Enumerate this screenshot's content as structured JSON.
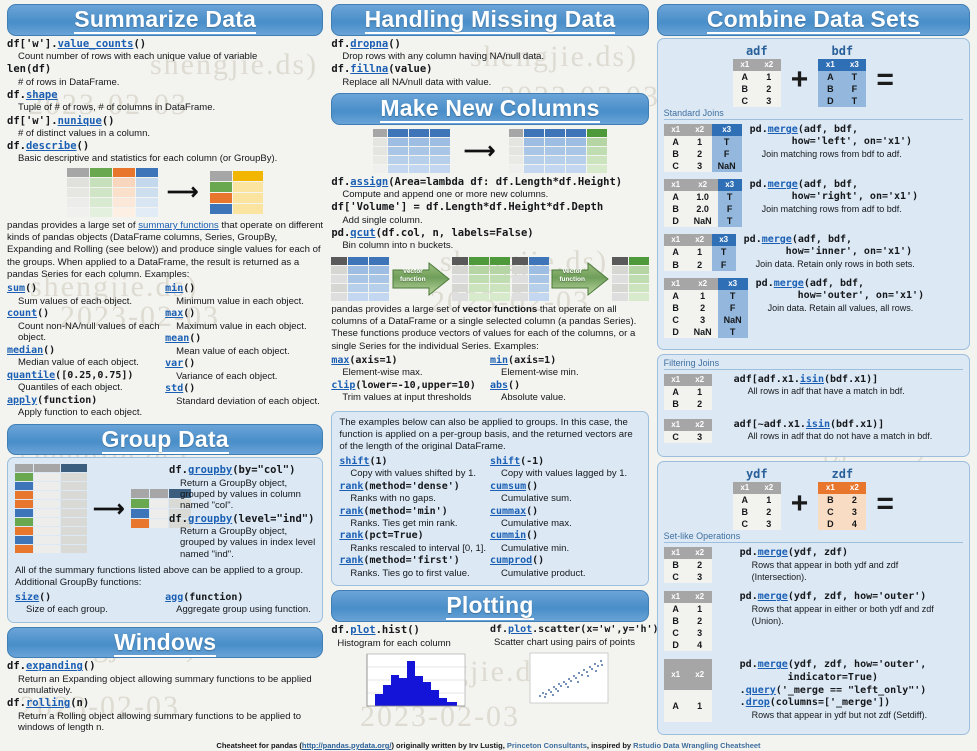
{
  "sections": {
    "summarize": {
      "title": "Summarize Data",
      "entries": [
        {
          "code_pre": "df['w'].",
          "code_link": "value_counts",
          "code_post": "()",
          "desc": "Count number of rows with each unique value of variable"
        },
        {
          "code_pre": "len(df)",
          "code_link": "",
          "code_post": "",
          "desc": "# of rows in DataFrame."
        },
        {
          "code_pre": "df.",
          "code_link": "shape",
          "code_post": "",
          "desc": "Tuple of # of rows, # of columns in DataFrame."
        },
        {
          "code_pre": "df['w'].",
          "code_link": "nunique",
          "code_post": "()",
          "desc": "# of distinct values in a column."
        },
        {
          "code_pre": "df.",
          "code_link": "describe",
          "code_post": "()",
          "desc": "Basic descriptive and statistics for each column (or GroupBy)."
        }
      ],
      "prose_1": "pandas provides a large set of ",
      "prose_link": "summary functions",
      "prose_2": " that operate on different kinds of pandas objects (DataFrame columns, Series, GroupBy, Expanding and Rolling (see below)) and produce single values for each of the groups. When applied to a DataFrame, the result is returned as a pandas Series for each column. Examples:",
      "funcs_left": [
        {
          "name": "sum",
          "args": "()",
          "desc": "Sum values of each object."
        },
        {
          "name": "count",
          "args": "()",
          "desc": "Count non-NA/null values of each object."
        },
        {
          "name": "median",
          "args": "()",
          "desc": "Median value of each object."
        },
        {
          "name": "quantile",
          "args": "([0.25,0.75])",
          "desc": "Quantiles of each object."
        },
        {
          "name": "apply",
          "args": "(function)",
          "desc": "Apply function to each object."
        }
      ],
      "funcs_right": [
        {
          "name": "min",
          "args": "()",
          "desc": "Minimum value in each object."
        },
        {
          "name": "max",
          "args": "()",
          "desc": "Maximum value in each object."
        },
        {
          "name": "mean",
          "args": "()",
          "desc": "Mean value of each object."
        },
        {
          "name": "var",
          "args": "()",
          "desc": "Variance of each object."
        },
        {
          "name": "std",
          "args": "()",
          "desc": "Standard deviation of each object."
        }
      ]
    },
    "group": {
      "title": "Group Data",
      "entries": [
        {
          "code_pre": "df.",
          "code_link": "groupby",
          "code_post": "(by=\"col\")",
          "desc": "Return a GroupBy object, grouped by values in column named \"col\"."
        },
        {
          "code_pre": "df.",
          "code_link": "groupby",
          "code_post": "(level=\"ind\")",
          "desc": "Return a GroupBy object, grouped by values in index level named \"ind\"."
        }
      ],
      "note": "All of the summary functions listed above can be applied to a group. Additional GroupBy functions:",
      "funcs_left": [
        {
          "name": "size",
          "args": "()",
          "desc": "Size of each group."
        }
      ],
      "funcs_right": [
        {
          "name": "agg",
          "args": "(function)",
          "desc": "Aggregate group using function."
        }
      ]
    },
    "windows": {
      "title": "Windows",
      "entries": [
        {
          "code_pre": "df.",
          "code_link": "expanding",
          "code_post": "()",
          "desc": "Return an Expanding object allowing summary functions to be applied cumulatively."
        },
        {
          "code_pre": "df.",
          "code_link": "rolling",
          "code_post": "(n)",
          "desc": "Return a Rolling object allowing summary functions to be applied to windows of length n."
        }
      ]
    },
    "missing": {
      "title": "Handling Missing Data",
      "entries": [
        {
          "code_pre": "df.",
          "code_link": "dropna",
          "code_post": "()",
          "desc": "Drop rows with any column having NA/null data."
        },
        {
          "code_pre": "df.",
          "code_link": "fillna",
          "code_post": "(value)",
          "desc": "Replace all NA/null data with value."
        }
      ]
    },
    "newcols": {
      "title": "Make New Columns",
      "entries": [
        {
          "code_pre": "df.",
          "code_link": "assign",
          "code_post": "(Area=lambda df: df.Length*df.Height)",
          "desc": "Compute and append one or more new columns."
        },
        {
          "code_pre": "df['Volume'] = df.Length*df.Height*df.Depth",
          "code_link": "",
          "code_post": "",
          "desc": "Add single column."
        },
        {
          "code_pre": "pd.",
          "code_link": "qcut",
          "code_post": "(df.col, n, labels=False)",
          "desc": "Bin column into n buckets."
        }
      ],
      "vector_label_1": "Vector",
      "vector_label_2": "function",
      "prose_1": "pandas provides a large set of ",
      "prose_bold": "vector functions",
      "prose_2": " that operate on all columns of a DataFrame or a single selected column (a pandas Series). These functions produce vectors of values for each of the columns, or a single Series for the individual Series. Examples:",
      "funcs_left": [
        {
          "name": "max",
          "args": "(axis=1)",
          "desc": "Element-wise max."
        },
        {
          "name": "clip",
          "args": "(lower=-10,upper=10)",
          "desc": "Trim values at input thresholds"
        }
      ],
      "funcs_right": [
        {
          "name": "min",
          "args": "(axis=1)",
          "desc": "Element-wise min."
        },
        {
          "name": "abs",
          "args": "()",
          "desc": "Absolute value."
        }
      ]
    },
    "groupvectors": {
      "note": "The examples below can also be applied to groups. In this case, the function is applied on a per-group basis, and the returned vectors are of the length of the original DataFrame.",
      "funcs_left": [
        {
          "name": "shift",
          "args": "(1)",
          "desc": "Copy with values shifted by 1."
        },
        {
          "name": "rank",
          "args": "(method='dense')",
          "desc": "Ranks with no gaps."
        },
        {
          "name": "rank",
          "args": "(method='min')",
          "desc": "Ranks. Ties get min rank."
        },
        {
          "name": "rank",
          "args": "(pct=True)",
          "desc": "Ranks rescaled to interval [0, 1]."
        },
        {
          "name": "rank",
          "args": "(method='first')",
          "desc": "Ranks. Ties go to first value."
        }
      ],
      "funcs_right": [
        {
          "name": "shift",
          "args": "(-1)",
          "desc": "Copy with values lagged by 1."
        },
        {
          "name": "cumsum",
          "args": "()",
          "desc": "Cumulative sum."
        },
        {
          "name": "cummax",
          "args": "()",
          "desc": "Cumulative max."
        },
        {
          "name": "cummin",
          "args": "()",
          "desc": "Cumulative min."
        },
        {
          "name": "cumprod",
          "args": "()",
          "desc": "Cumulative product."
        }
      ]
    },
    "plotting": {
      "title": "Plotting",
      "left": {
        "code_pre": "df.",
        "code_link": "plot",
        "code_post": ".hist()",
        "desc": "Histogram for each column"
      },
      "right": {
        "code_pre": "df.",
        "code_link": "plot",
        "code_post": ".scatter(x='w',y='h')",
        "desc": "Scatter chart using pairs of points"
      }
    },
    "combine": {
      "title": "Combine Data Sets",
      "adf_name": "adf",
      "bdf_name": "bdf",
      "ydf_name": "ydf",
      "zdf_name": "zdf",
      "plus": "+",
      "equals": "=",
      "standard_joins_label": "Standard Joins",
      "filtering_joins_label": "Filtering Joins",
      "setlike_label": "Set-like Operations",
      "adf": {
        "headers": [
          "x1",
          "x2"
        ],
        "rows": [
          [
            "A",
            "1"
          ],
          [
            "B",
            "2"
          ],
          [
            "C",
            "3"
          ]
        ]
      },
      "bdf": {
        "headers": [
          "x1",
          "x3"
        ],
        "rows": [
          [
            "A",
            "T"
          ],
          [
            "B",
            "F"
          ],
          [
            "D",
            "T"
          ]
        ]
      },
      "ydf": {
        "headers": [
          "x1",
          "x2"
        ],
        "rows": [
          [
            "A",
            "1"
          ],
          [
            "B",
            "2"
          ],
          [
            "C",
            "3"
          ]
        ]
      },
      "zdf": {
        "headers": [
          "x1",
          "x2"
        ],
        "rows": [
          [
            "B",
            "2"
          ],
          [
            "C",
            "3"
          ],
          [
            "D",
            "4"
          ]
        ]
      },
      "joins": [
        {
          "headers": [
            "x1",
            "x2",
            "x3"
          ],
          "rows": [
            [
              "A",
              "1",
              "T"
            ],
            [
              "B",
              "2",
              "F"
            ],
            [
              "C",
              "3",
              "NaN"
            ]
          ],
          "code_pre": "pd.",
          "code_link": "merge",
          "code_post": "(adf, bdf,",
          "code_line2": "how='left', on='x1')",
          "desc": "Join matching rows from bdf to adf."
        },
        {
          "headers": [
            "x1",
            "x2",
            "x3"
          ],
          "rows": [
            [
              "A",
              "1.0",
              "T"
            ],
            [
              "B",
              "2.0",
              "F"
            ],
            [
              "D",
              "NaN",
              "T"
            ]
          ],
          "code_pre": "pd.",
          "code_link": "merge",
          "code_post": "(adf, bdf,",
          "code_line2": "how='right', on='x1')",
          "desc": "Join matching rows from adf to bdf."
        },
        {
          "headers": [
            "x1",
            "x2",
            "x3"
          ],
          "rows": [
            [
              "A",
              "1",
              "T"
            ],
            [
              "B",
              "2",
              "F"
            ]
          ],
          "code_pre": "pd.",
          "code_link": "merge",
          "code_post": "(adf, bdf,",
          "code_line2": "how='inner', on='x1')",
          "desc": "Join data. Retain only rows in both sets."
        },
        {
          "headers": [
            "x1",
            "x2",
            "x3"
          ],
          "rows": [
            [
              "A",
              "1",
              "T"
            ],
            [
              "B",
              "2",
              "F"
            ],
            [
              "C",
              "3",
              "NaN"
            ],
            [
              "D",
              "NaN",
              "T"
            ]
          ],
          "code_pre": "pd.",
          "code_link": "merge",
          "code_post": "(adf, bdf,",
          "code_line2": "how='outer', on='x1')",
          "desc": "Join data. Retain all values, all rows."
        }
      ],
      "filtering": [
        {
          "headers": [
            "x1",
            "x2"
          ],
          "rows": [
            [
              "A",
              "1"
            ],
            [
              "B",
              "2"
            ]
          ],
          "code_pre": "adf[adf.x1.",
          "code_link": "isin",
          "code_post": "(bdf.x1)]",
          "desc": "All rows in adf that have a match in bdf."
        },
        {
          "headers": [
            "x1",
            "x2"
          ],
          "rows": [
            [
              "C",
              "3"
            ]
          ],
          "code_pre": "adf[~adf.x1.",
          "code_link": "isin",
          "code_post": "(bdf.x1)]",
          "desc": "All rows in adf that do not have a match in bdf."
        }
      ],
      "setops": [
        {
          "headers": [
            "x1",
            "x2"
          ],
          "rows": [
            [
              "B",
              "2"
            ],
            [
              "C",
              "3"
            ]
          ],
          "code_pre": "pd.",
          "code_link": "merge",
          "code_post": "(ydf, zdf)",
          "desc_1": "Rows that appear in both ydf and zdf",
          "desc_2": "(Intersection)."
        },
        {
          "headers": [
            "x1",
            "x2"
          ],
          "rows": [
            [
              "A",
              "1"
            ],
            [
              "B",
              "2"
            ],
            [
              "C",
              "3"
            ],
            [
              "D",
              "4"
            ]
          ],
          "code_pre": "pd.",
          "code_link": "merge",
          "code_post": "(ydf, zdf, how='outer')",
          "desc_1": "Rows that appear in either or both ydf and zdf",
          "desc_2": "(Union)."
        },
        {
          "headers": [
            "x1",
            "x2"
          ],
          "rows": [
            [
              "A",
              "1"
            ]
          ],
          "code_pre": "pd.",
          "code_link": "merge",
          "code_post": "(ydf, zdf, how='outer',",
          "code_line2": "indicator=True)",
          "code_line3_link": "query",
          "code_line3": "('_merge == \"left_only\"')",
          "code_line4_link": "drop",
          "code_line4": "(columns=['_merge'])",
          "desc_1": "Rows that appear in ydf but not zdf (Setdiff)."
        }
      ]
    }
  },
  "footer": {
    "t1": "Cheatsheet for pandas (",
    "link": "http://pandas.pydata.org/",
    "t2": ") originally written by Irv Lustig, ",
    "org": "Princeton Consultants",
    "t3": ", inspired by ",
    "org2": "Rstudio Data Wrangling Cheatsheet"
  },
  "watermark": {
    "a": "shengjie.ds)",
    "b": "2023-02-03"
  },
  "colors": {
    "banner": "#4a8fc9",
    "panel": "#dce9f5",
    "link": "#1a5fb4",
    "header_gray": "#a6a6a6",
    "header_blue": "#2f6fb5",
    "header_orange": "#e8762c",
    "page_bg": "#f3f3ef"
  }
}
